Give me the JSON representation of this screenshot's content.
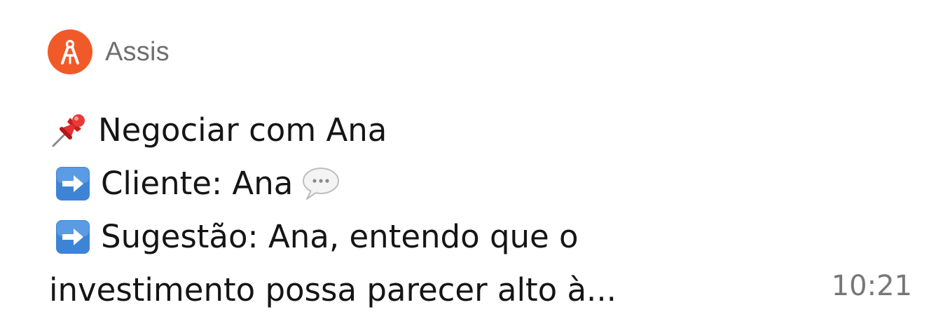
{
  "notification": {
    "sender": "Assis",
    "time": "10:21",
    "lines": {
      "title": "Negociar com Ana",
      "client": "Cliente: Ana",
      "suggestion": "Sugestão: Ana, entendo que o",
      "continuation": "investimento possa parecer alto à..."
    },
    "icons": {
      "avatar": "assis-logo-icon",
      "title": "pushpin-icon",
      "bullet": "right-arrow-icon",
      "client_suffix": "speech-bubble-icon"
    }
  },
  "colors": {
    "avatar_bg": "#f05a28",
    "arrow_box": "#3d84d6",
    "secondary_text": "#6f6f6f"
  }
}
